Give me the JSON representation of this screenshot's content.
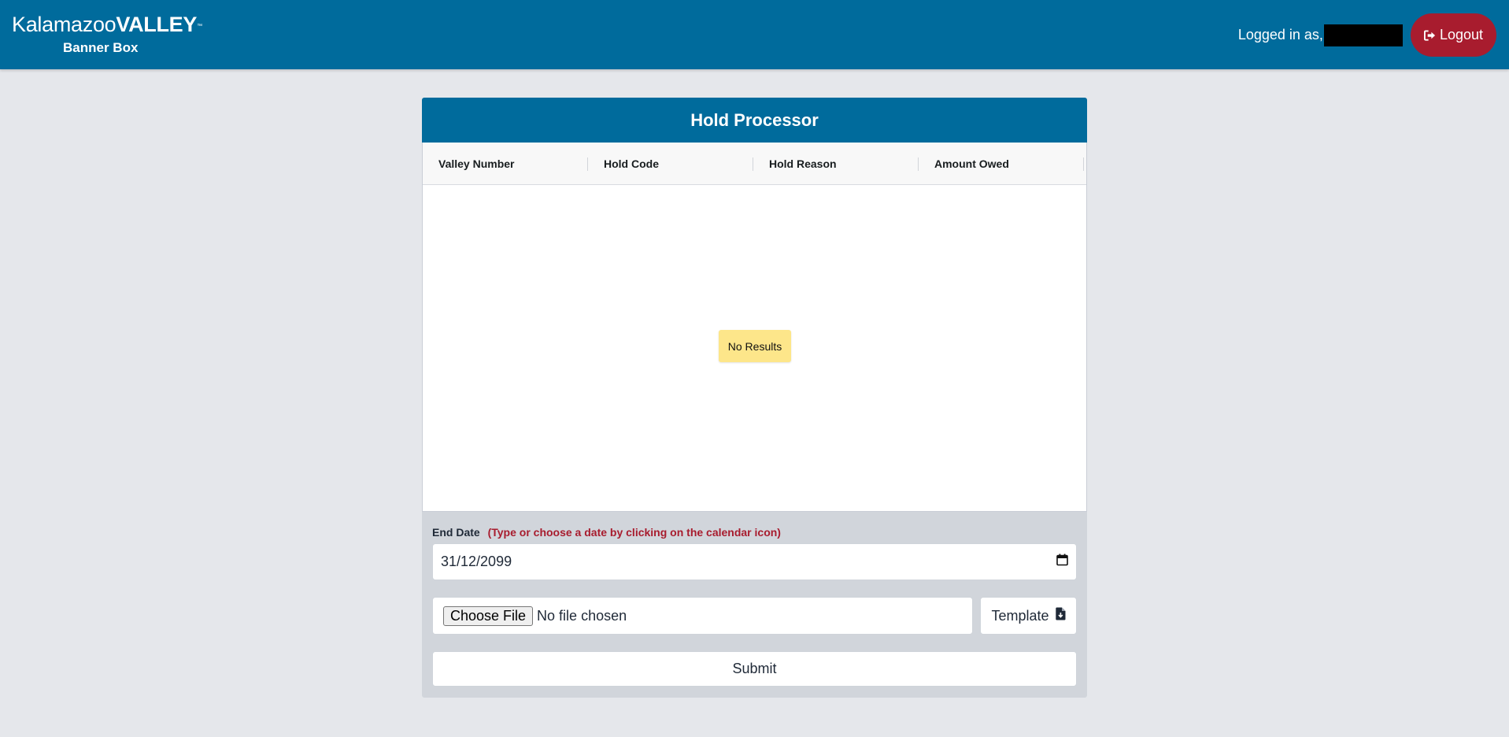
{
  "header": {
    "brand_light": "Kalamazoo",
    "brand_bold": "VALLEY",
    "brand_tm": "™",
    "app_name": "Banner Box",
    "logged_in_label": "Logged in as,",
    "logout_label": "Logout"
  },
  "card": {
    "title": "Hold Processor",
    "columns": [
      "Valley Number",
      "Hold Code",
      "Hold Reason",
      "Amount Owed"
    ],
    "empty_message": "No Results"
  },
  "form": {
    "end_date_label": "End Date",
    "end_date_hint": "(Type or choose a date by clicking on the calendar icon)",
    "end_date_value": "31/12/2099",
    "choose_file_label": "Choose File",
    "file_status": "No file chosen",
    "template_label": "Template",
    "submit_label": "Submit"
  },
  "colors": {
    "header_bg": "#006b9c",
    "logout_bg": "#a81c2e",
    "hint_text": "#a81c2e",
    "no_results_bg": "#fde68a",
    "page_bg": "#e5e7eb"
  },
  "icons": {
    "logout": "sign-out-icon",
    "calendar": "calendar-icon",
    "template": "file-download-icon"
  }
}
